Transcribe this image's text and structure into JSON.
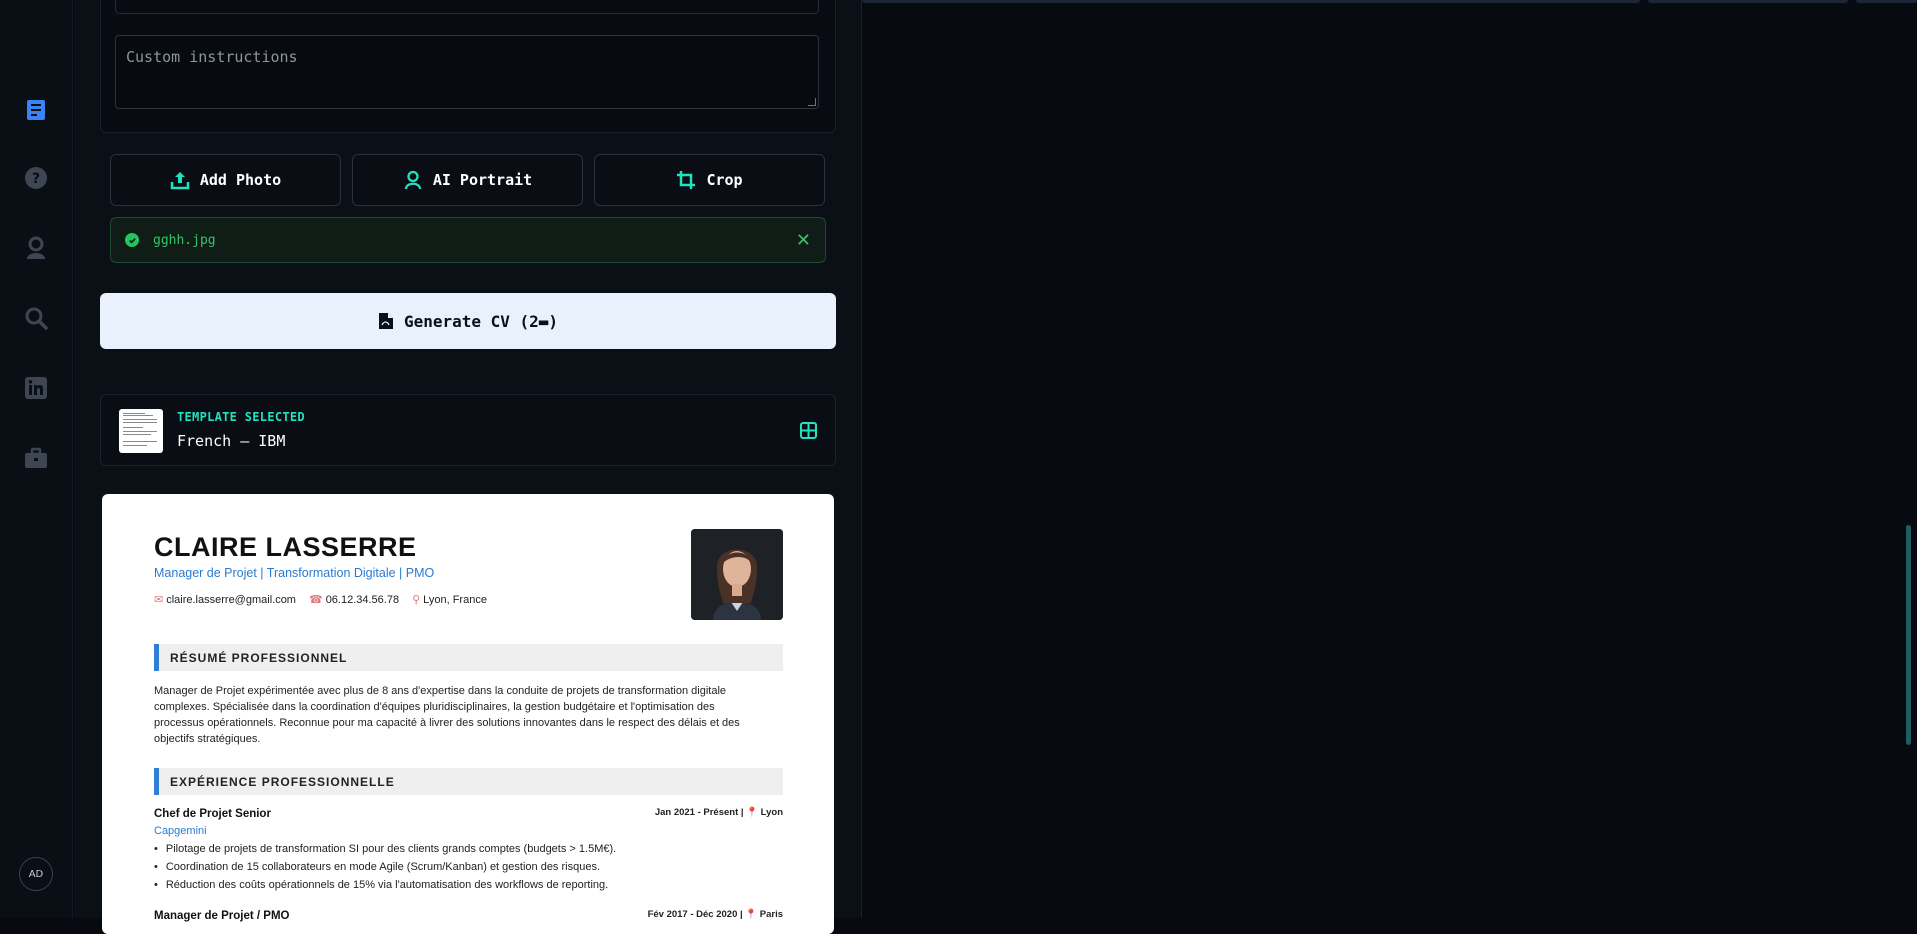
{
  "sidebar": {
    "icons": [
      "resume-icon",
      "help-icon",
      "portrait-icon",
      "search-icon",
      "linkedin-icon",
      "briefcase-icon"
    ],
    "avatar": "AD"
  },
  "form": {
    "custom_instructions_placeholder": "Custom instructions",
    "add_photo": "Add Photo",
    "ai_portrait": "AI Portrait",
    "crop": "Crop",
    "file_name": "gghh.jpg",
    "generate_label": "Generate CV (2▬)"
  },
  "template": {
    "label": "TEMPLATE SELECTED",
    "name": "French — IBM"
  },
  "cv": {
    "name": "CLAIRE LASSERRE",
    "title": "Manager de Projet | Transformation Digitale | PMO",
    "email": "claire.lasserre@gmail.com",
    "phone": "06.12.34.56.78",
    "location": "Lyon, France",
    "summary_heading": "RÉSUMÉ PROFESSIONNEL",
    "summary": "Manager de Projet expérimentée avec plus de 8 ans d'expertise dans la conduite de projets de transformation digitale complexes. Spécialisée dans la coordination d'équipes pluridisciplinaires, la gestion budgétaire et l'optimisation des processus opérationnels. Reconnue pour ma capacité à livrer des solutions innovantes dans le respect des délais et des objectifs stratégiques.",
    "experience_heading": "EXPÉRIENCE PROFESSIONNELLE",
    "jobs": [
      {
        "title": "Chef de Projet Senior",
        "dates": "Jan 2021 - Présent | 📍 Lyon",
        "company": "Capgemini",
        "bullets": [
          "Pilotage de projets de transformation SI pour des clients grands comptes (budgets > 1.5M€).",
          "Coordination de 15 collaborateurs en mode Agile (Scrum/Kanban) et gestion des risques.",
          "Réduction des coûts opérationnels de 15% via l'automatisation des workflows de reporting."
        ]
      },
      {
        "title": "Manager de Projet / PMO",
        "dates": "Fév 2017 - Déc 2020 | 📍 Paris"
      }
    ]
  },
  "colors": {
    "accent": "#22e0c0",
    "success": "#22c55e",
    "cv_blue": "#2a7bd0"
  }
}
